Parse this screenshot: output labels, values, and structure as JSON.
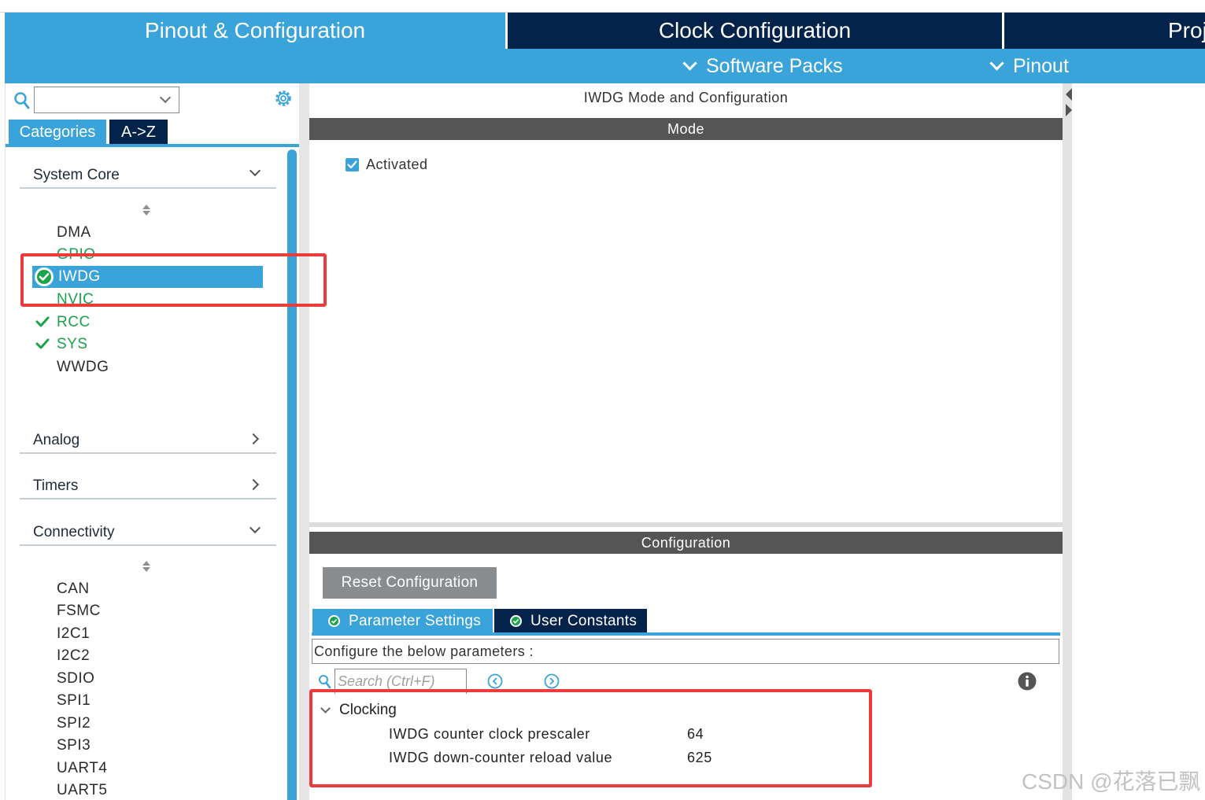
{
  "top_tabs": {
    "pinout": "Pinout & Configuration",
    "clock": "Clock Configuration",
    "project": "Proj"
  },
  "sub_menu": {
    "software_packs": "Software Packs",
    "pinout": "Pinout"
  },
  "left_panel": {
    "search": {
      "value": ""
    },
    "tabs": {
      "categories": "Categories",
      "atoz": "A->Z"
    },
    "categories": {
      "system_core": "System Core",
      "analog": "Analog",
      "timers": "Timers",
      "connectivity": "Connectivity"
    },
    "system_core_items": {
      "dma": "DMA",
      "gpio": "GPIO",
      "iwdg": "IWDG",
      "nvic": "NVIC",
      "rcc": "RCC",
      "sys": "SYS",
      "wwdg": "WWDG"
    },
    "connectivity_items": [
      "CAN",
      "FSMC",
      "I2C1",
      "I2C2",
      "SDIO",
      "SPI1",
      "SPI2",
      "SPI3",
      "UART4",
      "UART5"
    ]
  },
  "main": {
    "title": "IWDG Mode and Configuration",
    "mode_header": "Mode",
    "activated_label": "Activated",
    "activated_checked": true,
    "config_header": "Configuration",
    "reset_button": "Reset Configuration",
    "param_tabs": {
      "parameter_settings": "Parameter Settings",
      "user_constants": "User Constants"
    },
    "config_description": "Configure the below parameters :",
    "search_placeholder": "Search (Ctrl+F)",
    "group": "Clocking",
    "params": [
      {
        "name": "IWDG counter clock prescaler",
        "value": "64"
      },
      {
        "name": "IWDG down-counter reload value",
        "value": "625"
      }
    ]
  },
  "watermark": "CSDN @花落已飘",
  "colors": {
    "accent": "#3aa3d9",
    "navy": "#03234b",
    "section_bar": "#555555",
    "highlight_frame": "#ec3b3b",
    "ok_green": "#1aa34a"
  }
}
